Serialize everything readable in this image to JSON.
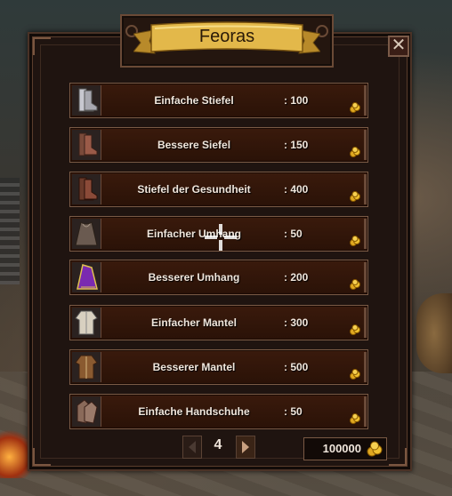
{
  "shop": {
    "title": "Feoras",
    "close_label": "✕",
    "items": [
      {
        "name": "Einfache Stiefel",
        "price": ": 100",
        "icon": "boots-icon"
      },
      {
        "name": "Bessere Siefel",
        "price": ": 150",
        "icon": "boots-icon"
      },
      {
        "name": "Stiefel der Gesundheit",
        "price": ": 400",
        "icon": "boots-icon"
      },
      {
        "name": "Einfacher Umhang",
        "price": ": 50",
        "icon": "cape-icon"
      },
      {
        "name": "Besserer Umhang",
        "price": ": 200",
        "icon": "cape-icon"
      },
      {
        "name": "Einfacher Mantel",
        "price": ": 300",
        "icon": "coat-icon"
      },
      {
        "name": "Besserer Mantel",
        "price": ": 500",
        "icon": "coat-icon"
      },
      {
        "name": "Einfache Handschuhe",
        "price": ": 50",
        "icon": "gloves-icon"
      }
    ],
    "page": "4",
    "gold": "100000"
  },
  "colors": {
    "panel": "#1f1410",
    "row": "#3a1a0c",
    "ribbon": "#e3b84a",
    "text": "#f0e6dc"
  }
}
